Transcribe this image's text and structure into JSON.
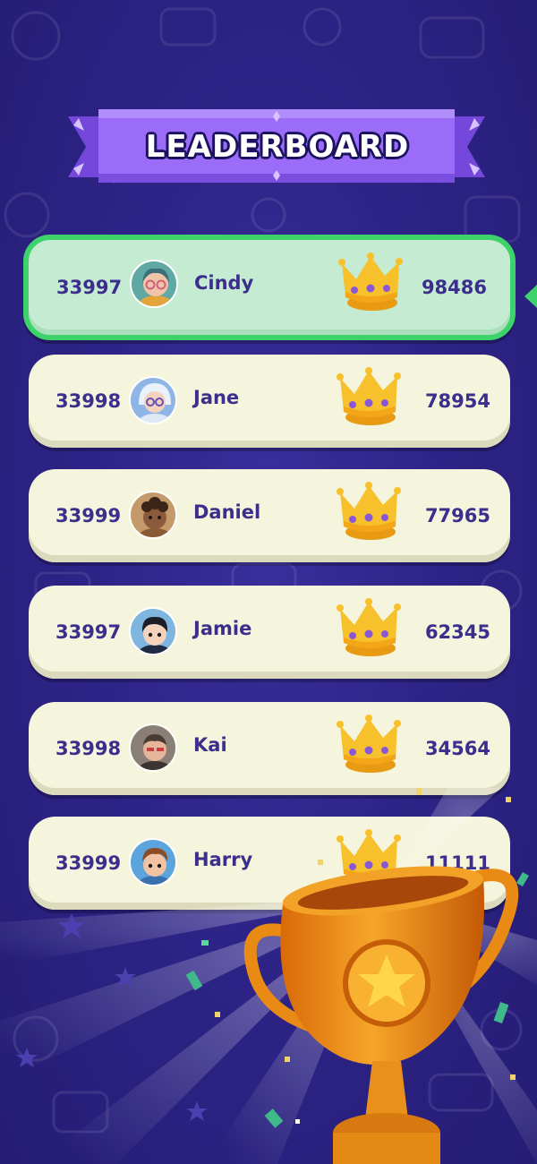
{
  "header": {
    "title": "LEADERBOARD"
  },
  "players": [
    {
      "rank": "33997",
      "name": "Cindy",
      "score": "98486",
      "highlighted": true,
      "avatar": "girl-glasses-avatar",
      "avatar_color": "#5fa8a4"
    },
    {
      "rank": "33998",
      "name": "Jane",
      "score": "78954",
      "highlighted": false,
      "avatar": "girl-hood-avatar",
      "avatar_color": "#8fb4e6"
    },
    {
      "rank": "33999",
      "name": "Daniel",
      "score": "77965",
      "highlighted": false,
      "avatar": "boy-curly-avatar",
      "avatar_color": "#c59a6a"
    },
    {
      "rank": "33997",
      "name": "Jamie",
      "score": "62345",
      "highlighted": false,
      "avatar": "boy-dark-hair-avatar",
      "avatar_color": "#7fb6df"
    },
    {
      "rank": "33998",
      "name": "Kai",
      "score": "34564",
      "highlighted": false,
      "avatar": "boy-hooded-avatar",
      "avatar_color": "#8a7f76"
    },
    {
      "rank": "33999",
      "name": "Harry",
      "score": "11111",
      "highlighted": false,
      "avatar": "boy-brown-hair-avatar",
      "avatar_color": "#5ba4dc"
    }
  ],
  "colors": {
    "background": "#2e2488",
    "ribbon": "#8f62f2",
    "row": "#f5f4dc",
    "row_active": "#c5ecd2",
    "row_active_border": "#3ed36a",
    "text": "#3b2e8c",
    "crown": "#f4b21d",
    "trophy": "#f09a1a"
  }
}
